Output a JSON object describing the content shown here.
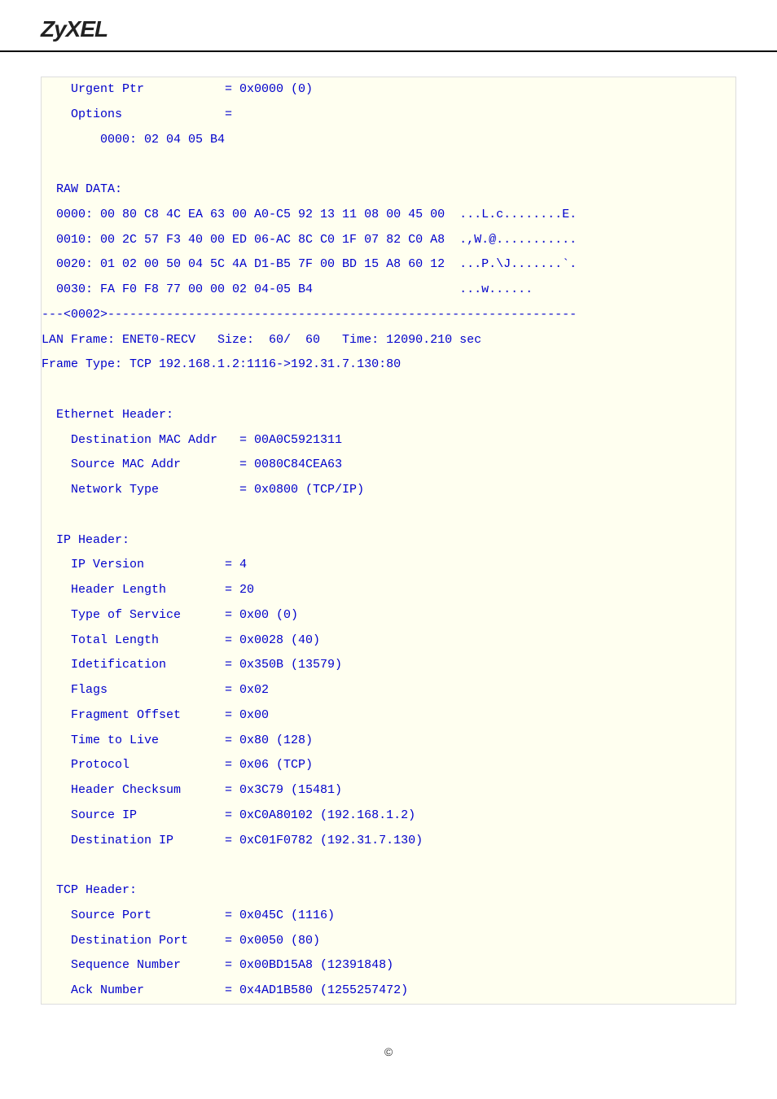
{
  "brand": "ZyXEL",
  "packet_trace": {
    "prev_tail": {
      "urgent_ptr": "    Urgent Ptr           = 0x0000 (0)",
      "options": "    Options              =",
      "opt_bytes": "        0000: 02 04 05 B4",
      "raw_header": "  RAW DATA:",
      "raw0": "  0000: 00 80 C8 4C EA 63 00 A0-C5 92 13 11 08 00 45 00  ...L.c........E.",
      "raw1": "  0010: 00 2C 57 F3 40 00 ED 06-AC 8C C0 1F 07 82 C0 A8  .,W.@...........",
      "raw2": "  0020: 01 02 00 50 04 5C 4A D1-B5 7F 00 BD 15 A8 60 12  ...P.\\J.......`.",
      "raw3": "  0030: FA F0 F8 77 00 00 02 04-05 B4                    ...w......"
    },
    "divider": "---<0002>----------------------------------------------------------------",
    "frame_line": "LAN Frame: ENET0-RECV   Size:  60/  60   Time: 12090.210 sec",
    "frame_type": "Frame Type: TCP 192.168.1.2:1116->192.31.7.130:80",
    "eth_header": {
      "title": "  Ethernet Header:",
      "dst_mac": "    Destination MAC Addr   = 00A0C5921311",
      "src_mac": "    Source MAC Addr        = 0080C84CEA63",
      "net_type": "    Network Type           = 0x0800 (TCP/IP)"
    },
    "ip_header": {
      "title": "  IP Header:",
      "version": "    IP Version           = 4",
      "hlen": "    Header Length        = 20",
      "tos": "    Type of Service      = 0x00 (0)",
      "tlen": "    Total Length         = 0x0028 (40)",
      "ident": "    Idetification        = 0x350B (13579)",
      "flags": "    Flags                = 0x02",
      "frag": "    Fragment Offset      = 0x00",
      "ttl": "    Time to Live         = 0x80 (128)",
      "proto": "    Protocol             = 0x06 (TCP)",
      "cksum": "    Header Checksum      = 0x3C79 (15481)",
      "src_ip": "    Source IP            = 0xC0A80102 (192.168.1.2)",
      "dst_ip": "    Destination IP       = 0xC01F0782 (192.31.7.130)"
    },
    "tcp_header": {
      "title": "  TCP Header:",
      "sport": "    Source Port          = 0x045C (1116)",
      "dport": "    Destination Port     = 0x0050 (80)",
      "seq": "    Sequence Number      = 0x00BD15A8 (12391848)",
      "ack": "    Ack Number           = 0x4AD1B580 (1255257472)"
    }
  },
  "footer_symbol": "©"
}
